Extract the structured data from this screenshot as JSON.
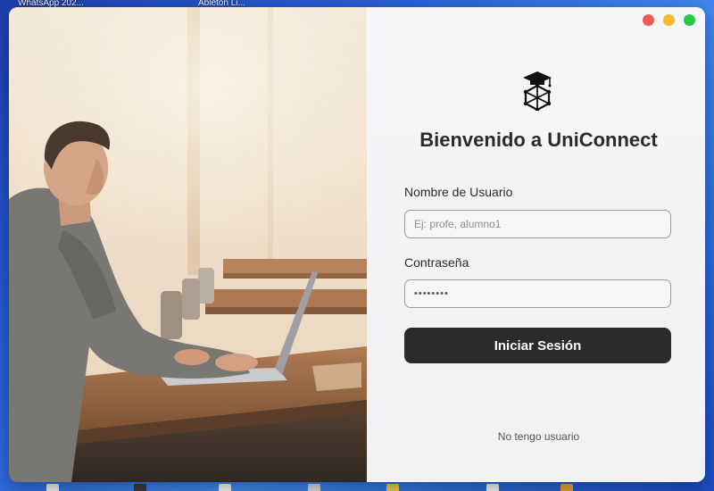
{
  "desktop": {
    "label_1": "WhatsApp 202...",
    "label_2": "Ableton Li..."
  },
  "window": {
    "controls": {
      "close_color": "#ee5a57",
      "minimize_color": "#f5bb2d",
      "maximize_color": "#2ec843"
    }
  },
  "branding": {
    "logo_icon": "graduation-cap-network-icon",
    "title": "Bienvenido a UniConnect"
  },
  "login_form": {
    "username_label": "Nombre de Usuario",
    "username_placeholder": "Ej: profe, alumno1",
    "username_value": "",
    "password_label": "Contraseña",
    "password_value": "••••••••",
    "submit_label": "Iniciar Sesión",
    "no_account_link": "No tengo usuario"
  },
  "colors": {
    "button_bg": "#2b2b2d",
    "panel_bg": "#f3f3f6",
    "text_primary": "#2b2b2b"
  }
}
